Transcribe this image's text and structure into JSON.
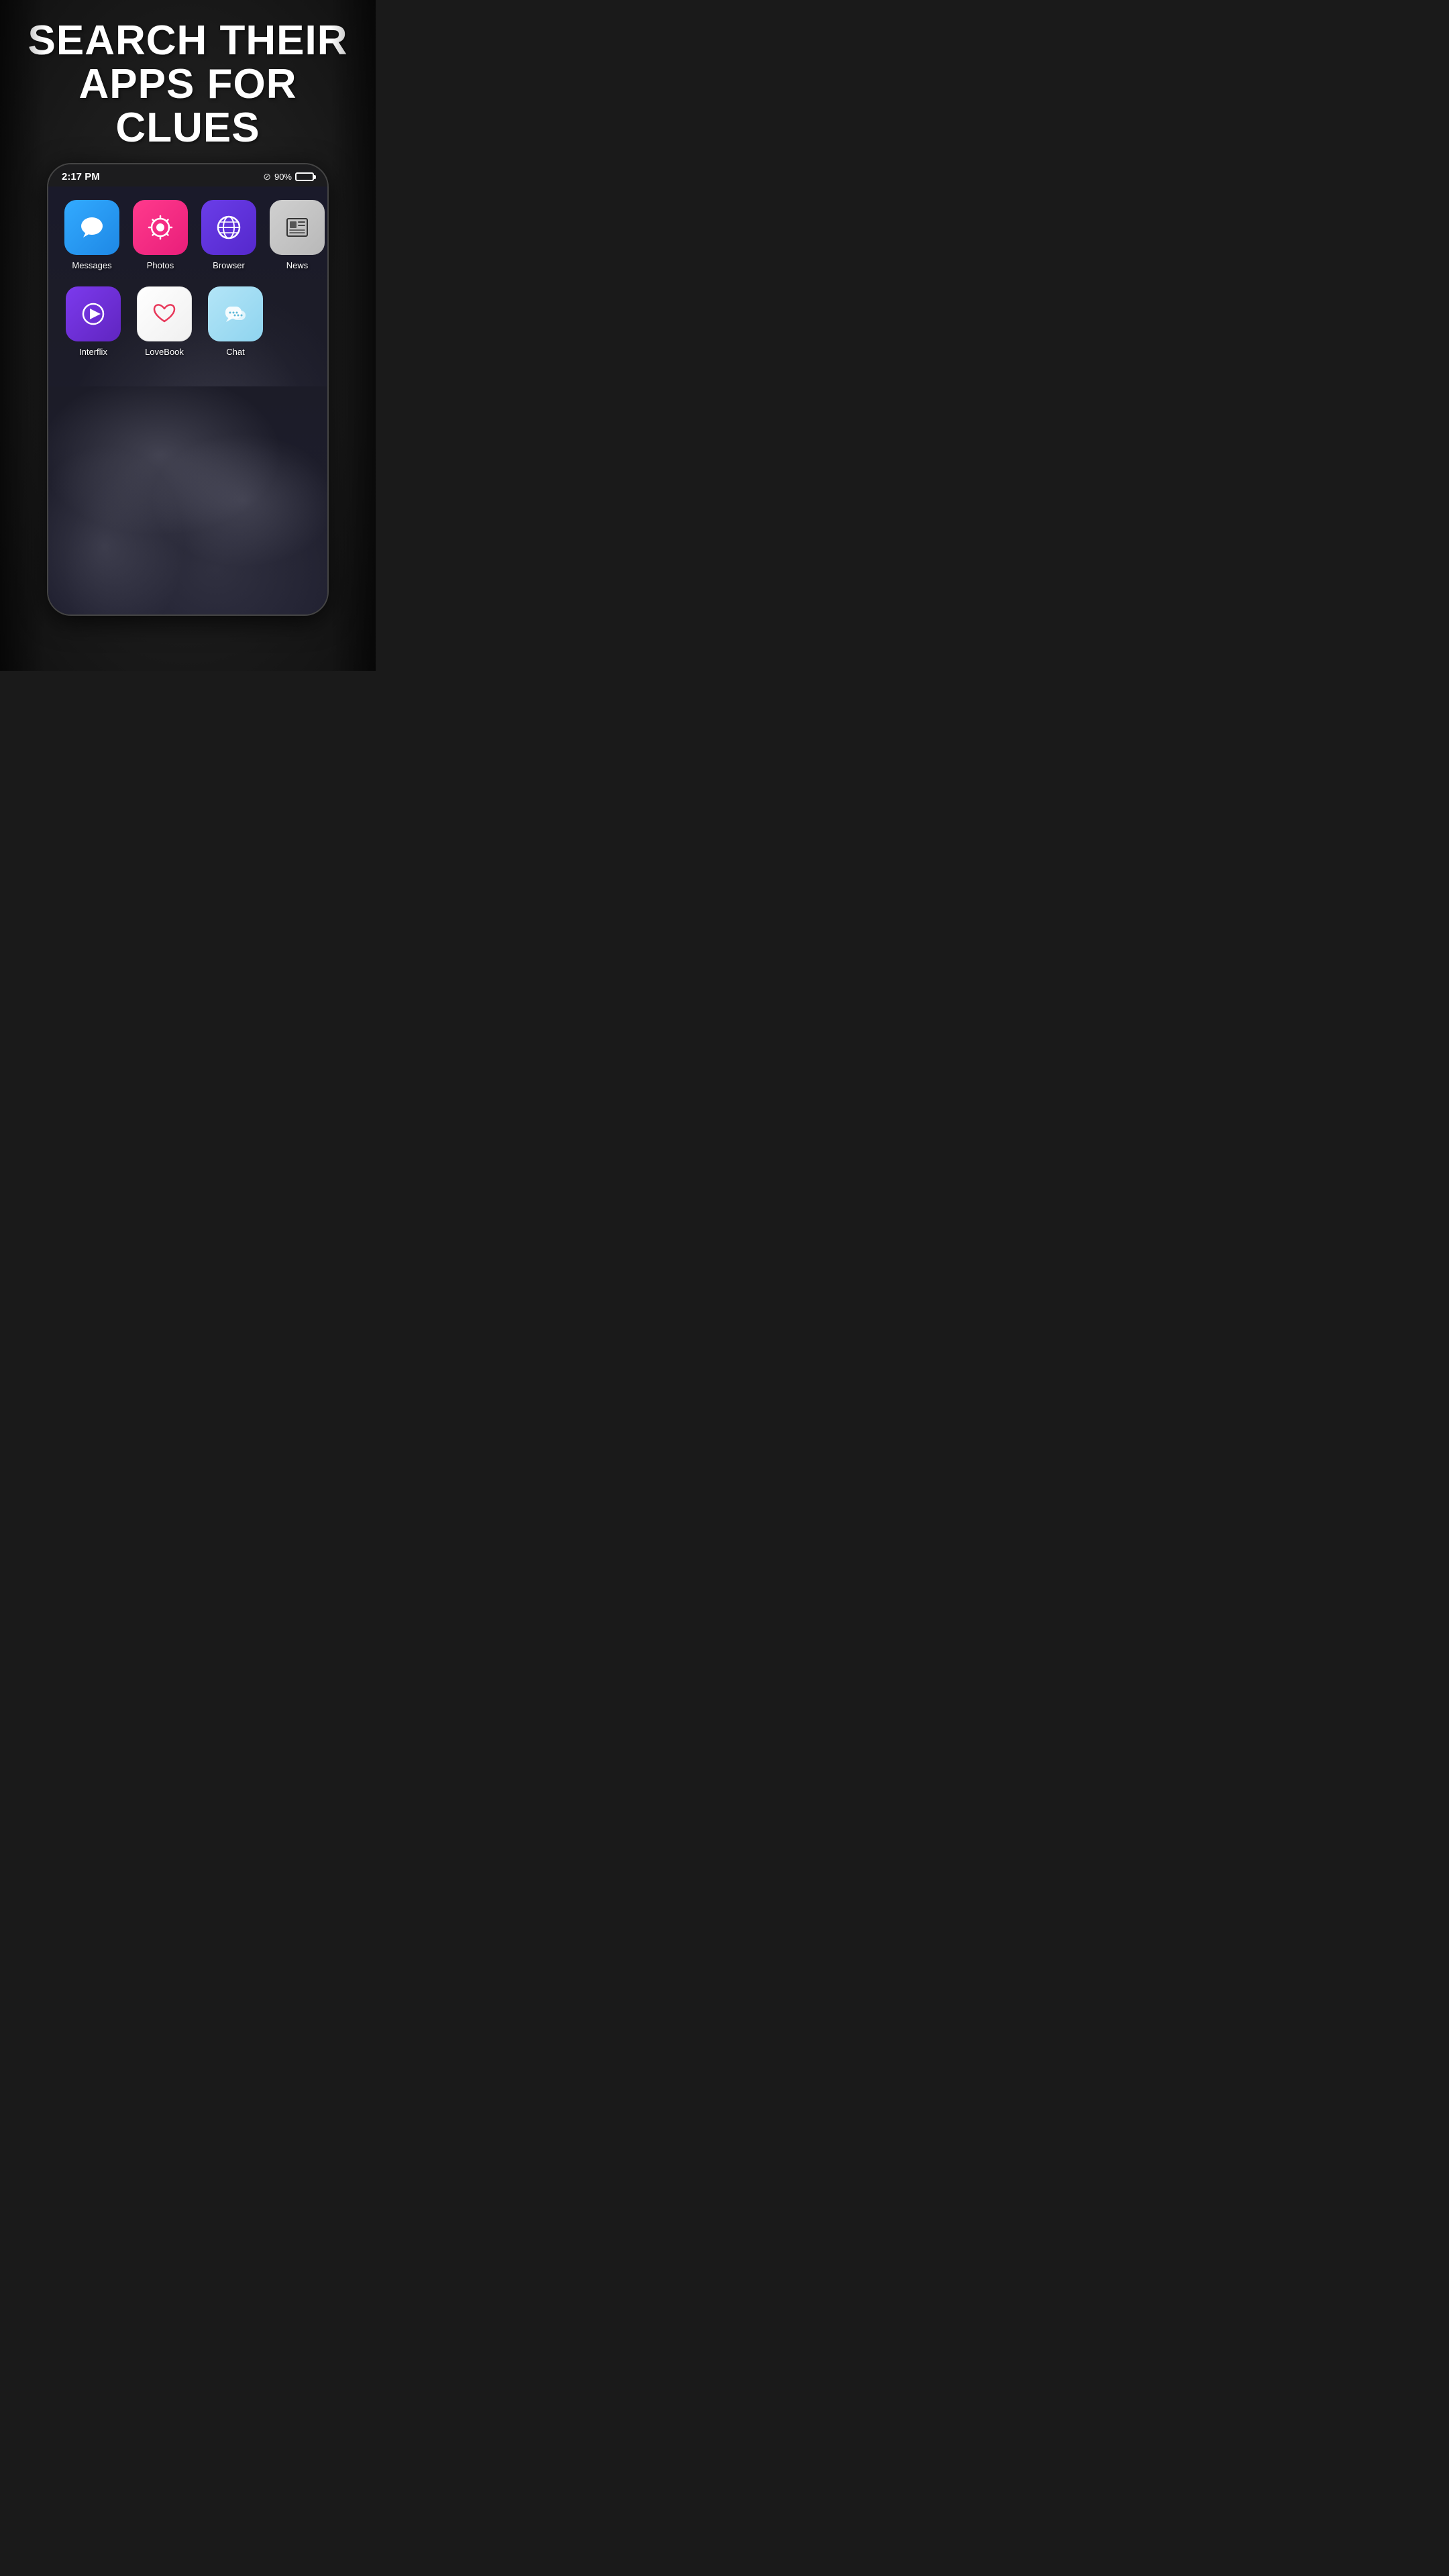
{
  "headline": {
    "line1": "SEARCH THEIR",
    "line2": "APPS FOR CLUES"
  },
  "status_bar": {
    "time": "2:17 PM",
    "battery_percent": "90%"
  },
  "apps": {
    "row1": [
      {
        "id": "messages",
        "label": "Messages",
        "icon_type": "messages"
      },
      {
        "id": "photos",
        "label": "Photos",
        "icon_type": "photos"
      },
      {
        "id": "browser",
        "label": "Browser",
        "icon_type": "browser"
      },
      {
        "id": "news",
        "label": "News",
        "icon_type": "news"
      }
    ],
    "row2": [
      {
        "id": "interflix",
        "label": "Interflix",
        "icon_type": "interflix"
      },
      {
        "id": "lovebook",
        "label": "LoveBook",
        "icon_type": "lovebook"
      },
      {
        "id": "chat",
        "label": "Chat",
        "icon_type": "chat"
      }
    ]
  }
}
